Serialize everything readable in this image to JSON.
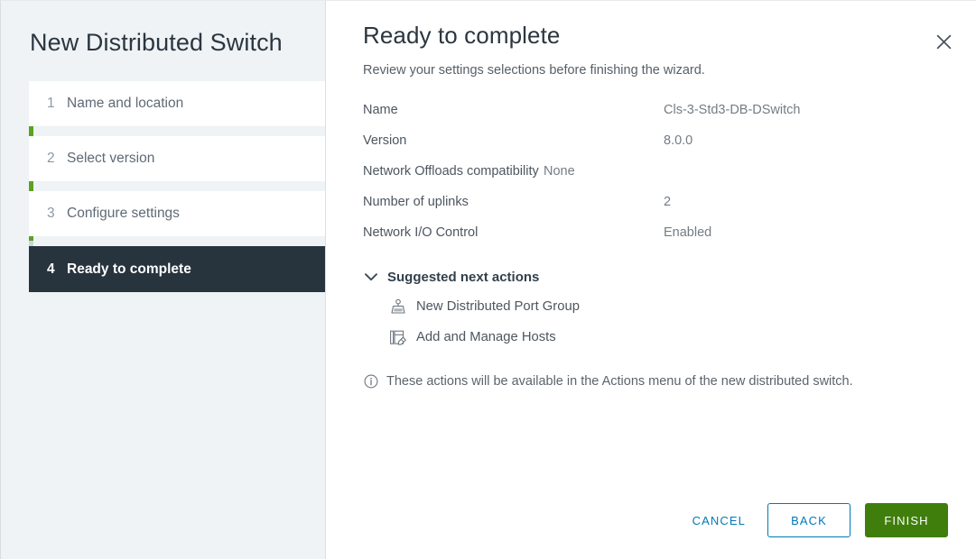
{
  "wizard": {
    "title": "New Distributed Switch",
    "steps": [
      {
        "number": "1",
        "label": "Name and location"
      },
      {
        "number": "2",
        "label": "Select version"
      },
      {
        "number": "3",
        "label": "Configure settings"
      },
      {
        "number": "4",
        "label": "Ready to complete"
      }
    ],
    "active_step_index": 3,
    "accent_green": "#5aa220",
    "active_step_bg": "#27333d"
  },
  "header": {
    "title": "Ready to complete",
    "subtitle": "Review your settings selections before finishing the wizard.",
    "close_icon": "close-icon"
  },
  "summary": {
    "rows": [
      {
        "key": "Name",
        "value": "Cls-3-Std3-DB-DSwitch"
      },
      {
        "key": "Version",
        "value": "8.0.0"
      },
      {
        "key": "Network Offloads compatibility",
        "value": "None"
      },
      {
        "key": "Number of uplinks",
        "value": "2"
      },
      {
        "key": "Network I/O Control",
        "value": "Enabled"
      }
    ]
  },
  "suggested_actions": {
    "title": "Suggested next actions",
    "expanded": true,
    "chevron_icon": "chevron-down-icon",
    "items": [
      {
        "label": "New Distributed Port Group",
        "icon": "distributed-port-group-icon"
      },
      {
        "label": "Add and Manage Hosts",
        "icon": "add-manage-hosts-icon"
      }
    ],
    "note": {
      "icon": "info-circle-icon",
      "text": "These actions will be available in the Actions menu of the new distributed switch."
    }
  },
  "footer": {
    "cancel_label": "CANCEL",
    "back_label": "BACK",
    "finish_label": "FINISH",
    "link_color": "#0079b8",
    "finish_color": "#3f7e0c"
  }
}
